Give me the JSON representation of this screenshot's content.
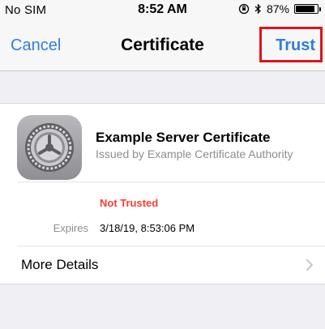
{
  "status_bar": {
    "carrier": "No SIM",
    "time": "8:52 AM",
    "battery_text": "87%",
    "battery_level": 0.87,
    "icons": [
      "orientation-lock-icon",
      "bluetooth-icon",
      "battery-icon"
    ]
  },
  "nav": {
    "cancel_label": "Cancel",
    "title": "Certificate",
    "trust_label": "Trust",
    "accent_color": "#2f7ee0",
    "highlight_color": "#e0121a"
  },
  "certificate": {
    "icon": "gear-icon",
    "name": "Example Server Certificate",
    "issuer": "Issued by Example Certificate Authority",
    "status": "Not Trusted",
    "status_color": "#ff3b30",
    "expires_label": "Expires",
    "expires_value": "3/18/19, 8:53:06 PM"
  },
  "details": {
    "more_details_label": "More Details",
    "chevron_icon": "chevron-right-icon"
  }
}
